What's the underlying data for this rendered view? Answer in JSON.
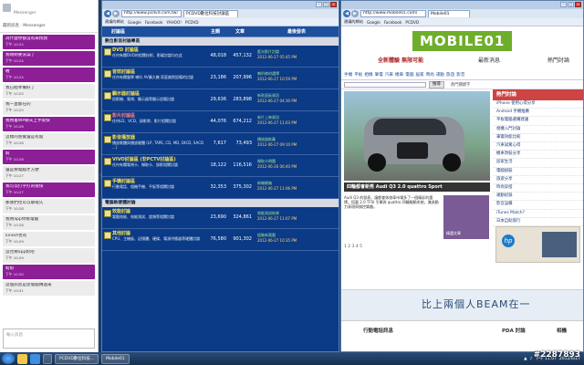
{
  "messenger": {
    "name": "",
    "sub": "Messenger",
    "status": "最新訊息 · Messenger",
    "input_placeholder": "輸入訊息",
    "messages": [
      {
        "side": "me",
        "text": "為什麼你都沒有來找我",
        "meta": "下午 10:24"
      },
      {
        "side": "me",
        "text": "我剛剛要洗澡了",
        "meta": "下午 10:24"
      },
      {
        "side": "me",
        "text": "喔",
        "meta": "下午 10:24"
      },
      {
        "side": "them",
        "text": "我已經準備好了",
        "meta": "下午 10:25"
      },
      {
        "side": "them",
        "text": "我一直都在的",
        "meta": "下午 10:25"
      },
      {
        "side": "me",
        "text": "我用着WP聊天上手很快",
        "meta": "下午 10:26"
      },
      {
        "side": "them",
        "text": "這樣的感覺還是有點",
        "meta": "下午 10:26"
      },
      {
        "side": "me",
        "text": "對",
        "meta": "下午 10:26"
      },
      {
        "side": "them",
        "text": "還是要電腦才方便",
        "meta": "下午 10:27"
      },
      {
        "side": "me",
        "text": "我可以打字打的很快",
        "meta": "下午 10:27"
      },
      {
        "side": "them",
        "text": "那我們也可以聊很久",
        "meta": "下午 10:28"
      },
      {
        "side": "them",
        "text": "我用app你看電腦",
        "meta": "下午 10:28"
      },
      {
        "side": "them",
        "text": "kinect也有",
        "meta": "下午 10:29"
      },
      {
        "side": "them",
        "text": "這也要app對吧",
        "meta": "下午 10:29"
      },
      {
        "side": "me",
        "text": "對對",
        "meta": "下午 10:30"
      },
      {
        "side": "them",
        "text": "這個訊息是從電腦傳過來",
        "meta": "下午 10:31"
      }
    ]
  },
  "browser1": {
    "url": "http://www.pcdvd.com.tw/",
    "tab": "PCDVD數位科技討論區",
    "favorites": [
      "建議的網站",
      "Google",
      "Facebook",
      "YAHOO!",
      "PCDVD"
    ],
    "forum": {
      "columns": {
        "board": "討論區",
        "topics": "主題",
        "posts": "文章",
        "last": "最後發表"
      },
      "section1": "數位影音討論專區",
      "section2": "電腦軟硬體討論",
      "rows": [
        {
          "name": "DVD 討論區",
          "desc": "任何有關DVD的相關技術、影碟討論均在此",
          "topics": "48,018",
          "posts": "457,132",
          "last_title": "藍光影片討論",
          "last_date": "2012-06-27 05:45 PM",
          "hot": false
        },
        {
          "name": "音效討論區",
          "desc": "任何有關聲學 喇叭 AV擴大機 家庭劇院設備的討論",
          "topics": "23,186",
          "posts": "207,996",
          "last_title": "喇叭線材選擇",
          "last_date": "2012-06-27 10:59 PM",
          "hot": false
        },
        {
          "name": "顯示器討論區",
          "desc": "投影機、電視、顯示器等顯示設備討論",
          "topics": "29,636",
          "posts": "283,898",
          "last_title": "新款面板資訊",
          "last_date": "2012-06-27 04:30 PM",
          "hot": false
        },
        {
          "name": "影片討論區",
          "desc": "任何LD、VCD、錄影帶、影片相關討論",
          "topics": "44,076",
          "posts": "674,212",
          "last_title": "新片上映資訊",
          "last_date": "2012-06-27 11:03 PM",
          "hot": true
        },
        {
          "name": "影音播放器",
          "desc": "播放軟體與播放硬體 (LP, TAPE, CD, MD, DtCD, SACD ...)",
          "topics": "7,617",
          "posts": "73,493",
          "last_title": "播放器推薦",
          "last_date": "2012-06-27 09:10 PM",
          "hot": false
        },
        {
          "name": "VIVO討論區 (非PCTV討論區)",
          "desc": "任何有關電視卡、擷取卡、錄影相關討論",
          "topics": "18,122",
          "posts": "116,516",
          "last_title": "擷取卡問題",
          "last_date": "2012-06-26 06:40 PM",
          "hot": false
        },
        {
          "name": "手機討論區",
          "desc": "行動電話、相機手機、平板等相關討論",
          "topics": "32,353",
          "posts": "375,302",
          "last_title": "新機開箱",
          "last_date": "2012-06-27 11:06 PM",
          "hot": false
        },
        {
          "name": "效能討論",
          "desc": "電腦效能、效能測試、超頻等相關討論",
          "topics": "23,690",
          "posts": "324,861",
          "last_title": "效能測試結果",
          "last_date": "2012-06-27 11:07 PM",
          "hot": false
        },
        {
          "name": "其他討論",
          "desc": "CPU、主機板、記憶體、硬碟、電源供應器等硬體討論",
          "topics": "76,580",
          "posts": "901,302",
          "last_title": "組裝新電腦",
          "last_date": "2012-06-27 10:35 PM",
          "hot": false
        }
      ]
    }
  },
  "browser2": {
    "url": "http://www.mobile01.com/",
    "tab": "Mobile01",
    "favorites": [
      "建議的網站",
      "Google",
      "Facebook",
      "PCDVD"
    ],
    "site": {
      "logo": "MOBILE01",
      "tagline": "全新體驗 無限可能",
      "tagline2": "最新消息",
      "tagline3": "熱門討論",
      "nav": [
        "手機",
        "平板",
        "相機",
        "筆電",
        "汽車",
        "機車",
        "電腦",
        "居家",
        "時尚",
        "運動",
        "旅遊",
        "影音"
      ],
      "search_button": "搜尋",
      "search_tags": "熱門關鍵字",
      "hero_caption": "四輪都會新秀 Audi Q3 2.0 quattro Sport",
      "article": "Audi Q3 的發表，讓都會休旅車市場多了一個精彩的選擇，搭載 2.0 TFSI 引擎與 quattro 四輪驅動系統，兼具動力表現與操控樂趣。",
      "thumb_label": "精選文章",
      "pager": "1 2 3 4 5",
      "right_title": "熱門討論",
      "right_links": [
        "iPhone 使用心得分享",
        "Android 手機推薦",
        "平板電腦選購建議",
        "相機入門討論",
        "筆電效能比較",
        "汽車試駕心得",
        "機車改裝分享",
        "居家生活",
        "電腦組裝",
        "旅遊分享",
        "時尚穿搭",
        "運動紀錄",
        "影音設備",
        "iTunes Match?",
        "日本自助旅行"
      ],
      "ad_logo": "hp",
      "banner": "比上兩個人BEAM在一",
      "sec_left": "行動電話訊息",
      "sec_mid": "PDA 討論",
      "sec_right": "相機"
    }
  },
  "taskbar": {
    "buttons": [
      "",
      "PCDVD數位科技...",
      "Mobile01"
    ],
    "clock": "下午 11:07",
    "date": "2012/6/27"
  },
  "watermark": "#2287893"
}
